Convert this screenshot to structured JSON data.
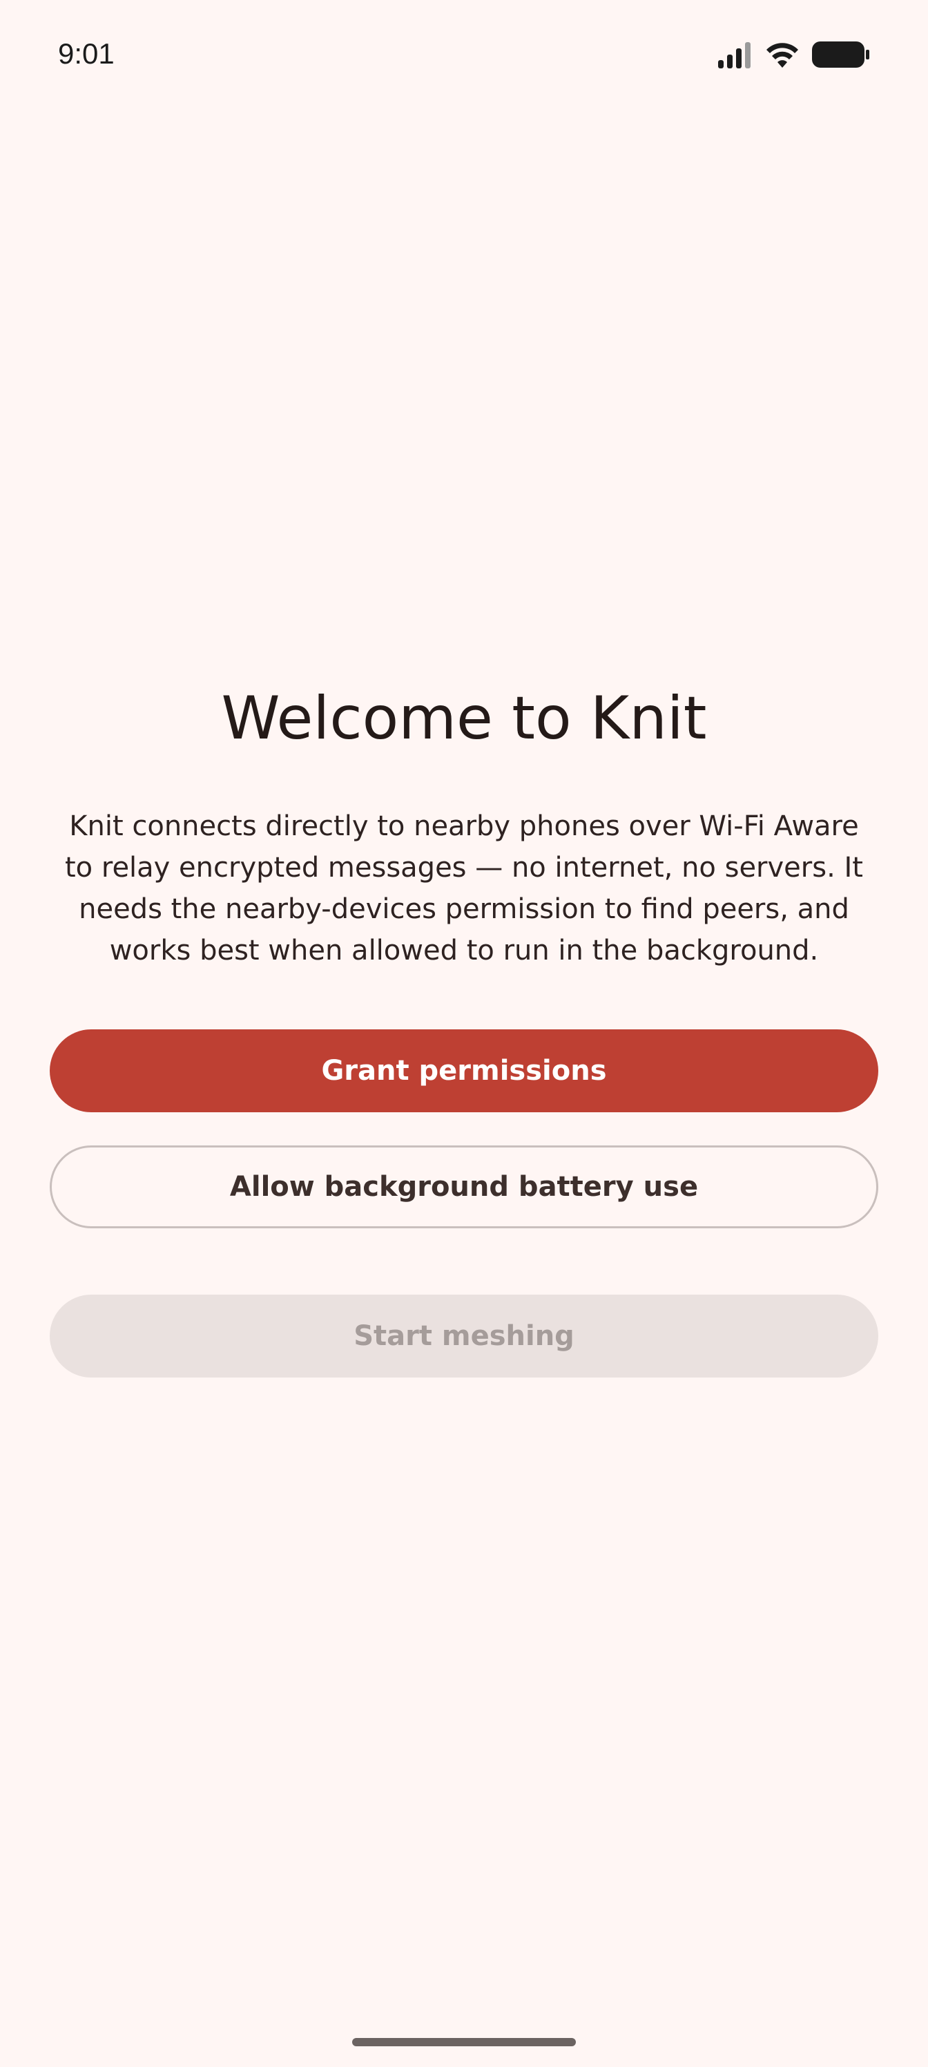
{
  "status_bar": {
    "time": "9:01",
    "icons": [
      "signal-icon",
      "wifi-icon",
      "battery-icon"
    ]
  },
  "welcome": {
    "title": "Welcome to Knit",
    "description": "Knit connects directly to nearby phones over Wi-Fi Aware to relay encrypted messages — no internet, no servers. It needs the nearby-devices permission to find peers, and works best when allowed to run in the background."
  },
  "actions": {
    "grant_permissions_label": "Grant permissions",
    "allow_battery_label": "Allow background battery use",
    "start_meshing_label": "Start meshing",
    "start_meshing_enabled": false
  },
  "colors": {
    "background": "#FFF6F4",
    "primary": "#BE4033",
    "on_primary": "#FFFFFF",
    "outline": "#C9BFBD",
    "disabled_container": "#EAE1DF",
    "disabled_text": "#A59C9A",
    "text": "#241A18"
  }
}
